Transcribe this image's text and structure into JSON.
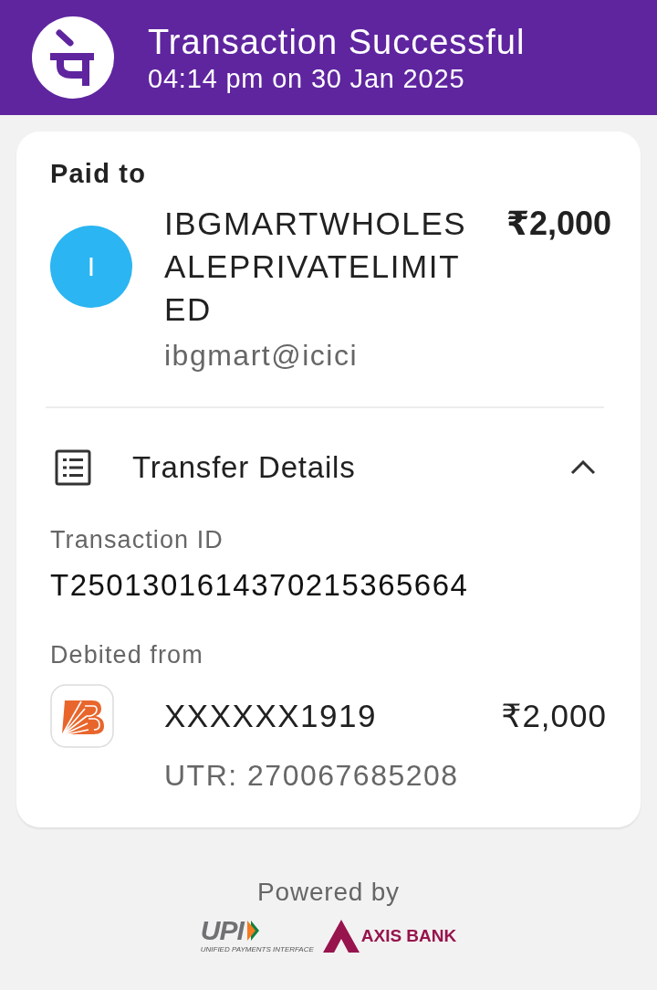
{
  "header": {
    "title": "Transaction Successful",
    "subtitle": "04:14 pm on 30 Jan 2025"
  },
  "paid_to": {
    "label": "Paid to",
    "avatar_initial": "I",
    "name": "IBGMARTWHOLESALEPRIVATELIMITED",
    "upi_id": "ibgmart@icici",
    "amount": "₹2,000"
  },
  "transfer_details": {
    "title": "Transfer Details",
    "expanded": true,
    "transaction_id_label": "Transaction ID",
    "transaction_id": "T2501301614370215365664",
    "debited_from_label": "Debited from",
    "account": "XXXXXX1919",
    "amount": "₹2,000",
    "utr": "UTR: 270067685208"
  },
  "footer": {
    "powered_by": "Powered by",
    "upi_logo": {
      "wordmark": "UPI",
      "tagline": "UNIFIED PAYMENTS INTERFACE"
    },
    "bank_logo": {
      "name": "AXIS BANK"
    }
  }
}
